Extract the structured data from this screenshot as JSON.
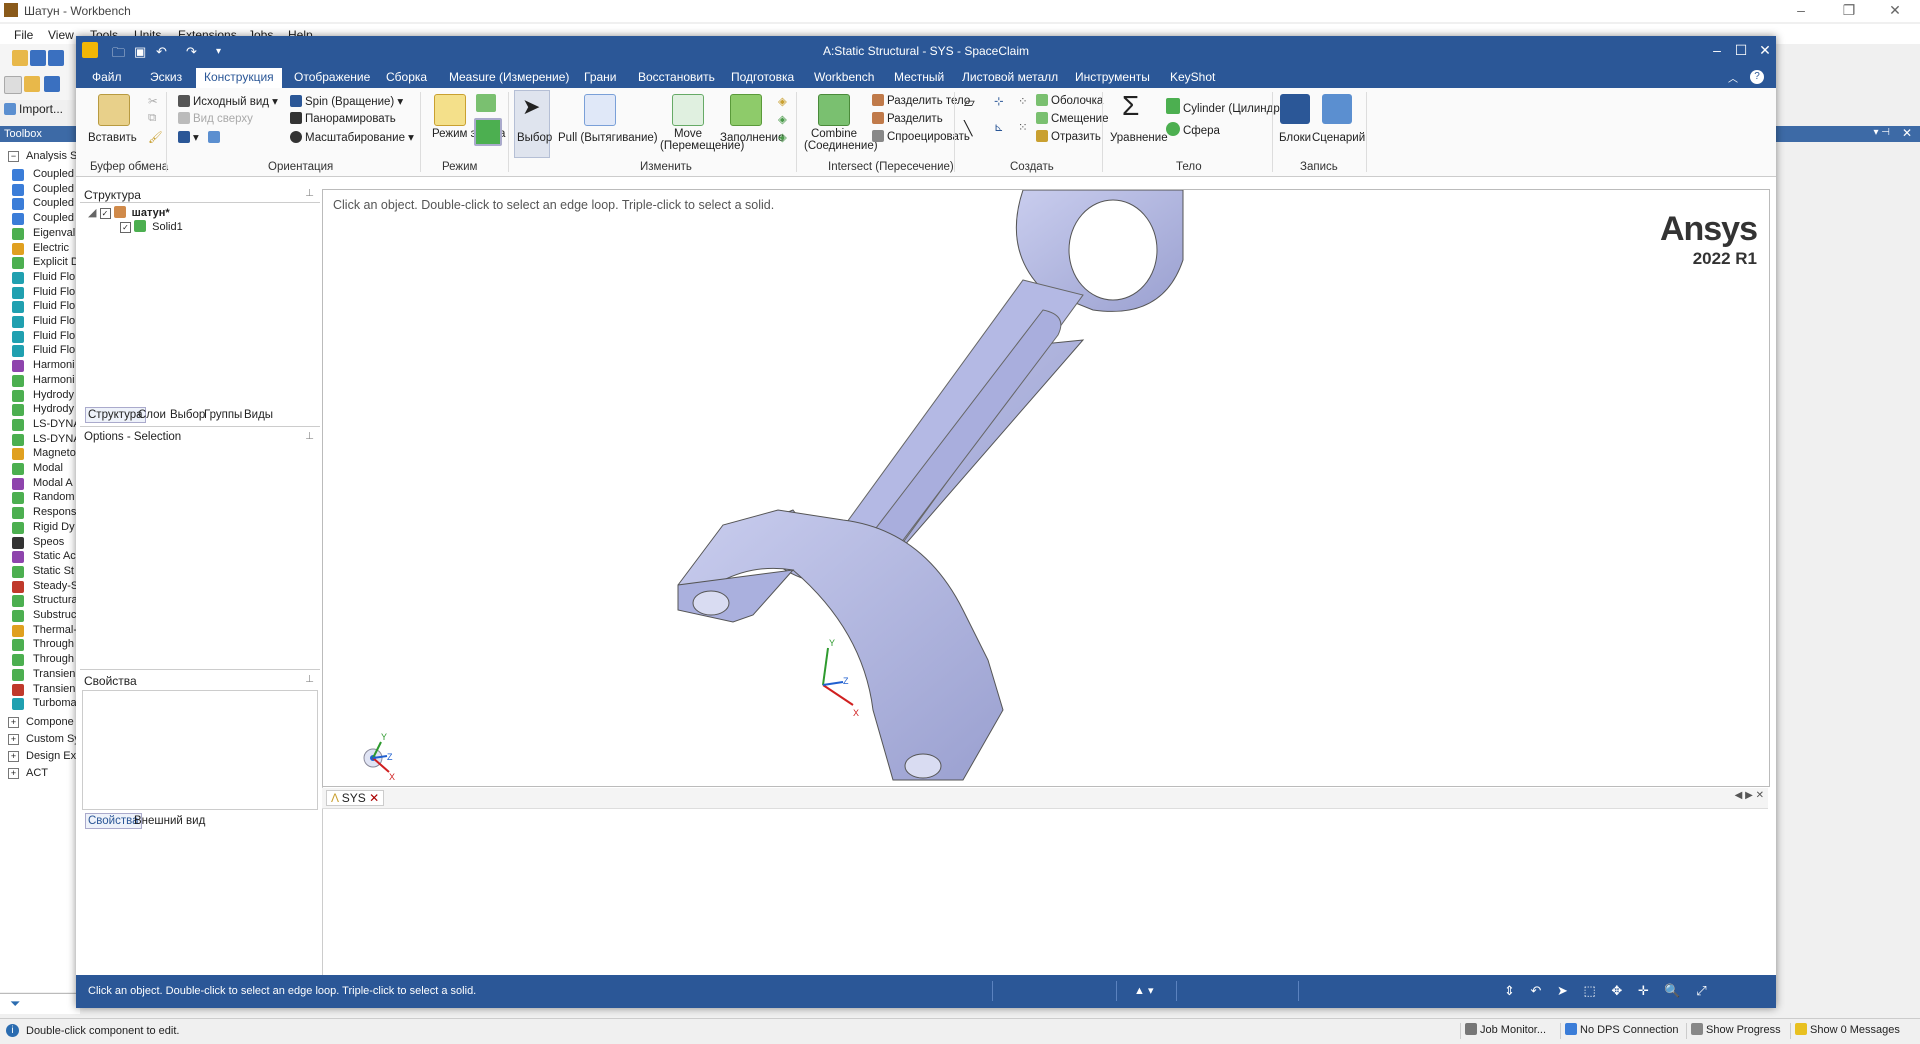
{
  "workbench": {
    "title": "Шатун - Workbench",
    "menu": [
      "File",
      "View",
      "Tools",
      "Units",
      "Extensions",
      "Jobs",
      "Help"
    ],
    "import_label": "Import...",
    "toolbox_title": "Toolbox",
    "toolbox_group_analysis": "Analysis S",
    "toolbox_items": [
      {
        "label": "Coupled",
        "color": "#3b7dd8"
      },
      {
        "label": "Coupled",
        "color": "#3b7dd8"
      },
      {
        "label": "Coupled",
        "color": "#3b7dd8"
      },
      {
        "label": "Coupled",
        "color": "#3b7dd8"
      },
      {
        "label": "Eigenval",
        "color": "#4caf50"
      },
      {
        "label": "Electric",
        "color": "#e0a020"
      },
      {
        "label": "Explicit D",
        "color": "#4caf50"
      },
      {
        "label": "Fluid Flo",
        "color": "#20a0b0"
      },
      {
        "label": "Fluid Flo",
        "color": "#20a0b0"
      },
      {
        "label": "Fluid Flo",
        "color": "#20a0b0"
      },
      {
        "label": "Fluid Flo",
        "color": "#20a0b0"
      },
      {
        "label": "Fluid Flo",
        "color": "#20a0b0"
      },
      {
        "label": "Fluid Flo",
        "color": "#20a0b0"
      },
      {
        "label": "Harmoni",
        "color": "#8e44ad"
      },
      {
        "label": "Harmoni",
        "color": "#4caf50"
      },
      {
        "label": "Hydrody",
        "color": "#4caf50"
      },
      {
        "label": "Hydrody",
        "color": "#4caf50"
      },
      {
        "label": "LS-DYNA",
        "color": "#4caf50"
      },
      {
        "label": "LS-DYNA",
        "color": "#4caf50"
      },
      {
        "label": "Magneto",
        "color": "#e0a020"
      },
      {
        "label": "Modal",
        "color": "#4caf50"
      },
      {
        "label": "Modal A",
        "color": "#8e44ad"
      },
      {
        "label": "Random",
        "color": "#4caf50"
      },
      {
        "label": "Respons",
        "color": "#4caf50"
      },
      {
        "label": "Rigid Dy",
        "color": "#4caf50"
      },
      {
        "label": "Speos",
        "color": "#333333"
      },
      {
        "label": "Static Ac",
        "color": "#8e44ad"
      },
      {
        "label": "Static St",
        "color": "#4caf50"
      },
      {
        "label": "Steady-S",
        "color": "#c0392b"
      },
      {
        "label": "Structura",
        "color": "#4caf50"
      },
      {
        "label": "Substruc",
        "color": "#4caf50"
      },
      {
        "label": "Thermal-",
        "color": "#e0a020"
      },
      {
        "label": "Through",
        "color": "#4caf50"
      },
      {
        "label": "Through",
        "color": "#4caf50"
      },
      {
        "label": "Transien",
        "color": "#4caf50"
      },
      {
        "label": "Transien",
        "color": "#c0392b"
      },
      {
        "label": "Turboma",
        "color": "#20a0b0"
      }
    ],
    "toolbox_groups": [
      "Compone",
      "Custom Sy",
      "Design Ex",
      "ACT"
    ],
    "status_message": "Double-click component to edit.",
    "status_buttons": [
      "Job Monitor...",
      "No DPS Connection",
      "Show Progress",
      "Show 0 Messages"
    ]
  },
  "spaceclaim": {
    "title": "A:Static Structural - SYS - SpaceClaim",
    "tabs": [
      "Файл",
      "Эскиз",
      "Конструкция",
      "Отображение",
      "Сборка",
      "Measure (Измерение)",
      "Грани",
      "Восстановить",
      "Подготовка",
      "Workbench",
      "Местный",
      "Листовой металл",
      "Инструменты",
      "KeyShot"
    ],
    "active_tab": "Конструкция",
    "ribbon": {
      "paste": "Вставить",
      "clipboard_group": "Буфер обмена",
      "home_view": "Исходный вид",
      "top_view": "Вид сверху",
      "spin": "Spin (Вращение)",
      "pan": "Панорамировать",
      "zoom": "Масштабирование",
      "orient_group": "Ориентация",
      "sketch_mode": "Режим эскиза",
      "mode_group": "Режим",
      "select": "Выбор",
      "pull": "Pull (Вытягивание)",
      "move": "Move (Перемещение)",
      "fill": "Заполнение",
      "edit_group": "Изменить",
      "combine": "Combine (Соединение)",
      "split_body": "Разделить тело",
      "split": "Разделить",
      "project": "Спроецировать",
      "intersect_group": "Intersect (Пересечение)",
      "shell": "Оболочка",
      "offset": "Смещение",
      "mirror": "Отразить",
      "create_group": "Создать",
      "equation": "Уравнение",
      "cylinder": "Cylinder (Цилиндр)",
      "sphere": "Сфера",
      "body_group": "Тело",
      "blocks": "Блоки",
      "script": "Сценарий",
      "record_group": "Запись"
    },
    "structure_title": "Структура",
    "tree_root": "шатун*",
    "tree_child": "Solid1",
    "panel_tabs": [
      "Структура",
      "Слои",
      "Выбор",
      "Группы",
      "Виды"
    ],
    "options_title": "Options - Selection",
    "props_title": "Свойства",
    "bottom_tabs": [
      "Свойства",
      "Внешний вид"
    ],
    "viewport_hint": "Click an object. Double-click to select an edge loop. Triple-click to select a solid.",
    "logo_text": "Ansys",
    "logo_version": "2022 R1",
    "doc_tab": "SYS",
    "status_message": "Click an object. Double-click to select an edge loop. Triple-click to select a solid.",
    "accent": "#2b5797",
    "part_color": "#b8bde6"
  }
}
